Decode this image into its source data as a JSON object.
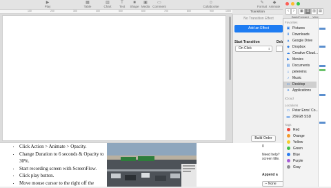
{
  "toolbar": {
    "items": [
      {
        "label": "Play",
        "icon": "play-icon"
      },
      {
        "label": "Table",
        "icon": "table-icon"
      },
      {
        "label": "Chart",
        "icon": "chart-icon"
      },
      {
        "label": "Text",
        "icon": "text-icon"
      },
      {
        "label": "Shape",
        "icon": "shape-icon"
      },
      {
        "label": "Media",
        "icon": "media-icon"
      },
      {
        "label": "Comment",
        "icon": "comment-icon"
      },
      {
        "label": "Collaborate",
        "icon": "collaborate-icon"
      },
      {
        "label": "Format",
        "icon": "format-icon"
      },
      {
        "label": "Animate",
        "icon": "animate-icon"
      }
    ]
  },
  "ruler": {
    "marks": [
      "100",
      "200",
      "300",
      "400",
      "500",
      "600",
      "700",
      "800",
      "900",
      "1000"
    ]
  },
  "inspector": {
    "tab_label": "Transition",
    "no_transition": "No Transition Effect",
    "add_effect": "Add an Effect",
    "start_label": "Start Transition",
    "delay_label": "Delay",
    "start_value": "On Click",
    "build_order": "Build Order"
  },
  "document": {
    "steps": [
      "Click Action > Animate > Opacity.",
      "Change Duration to 6 seconds & Opacity to 30%.",
      "Start recording screen with ScreenFlow.",
      "Click play button.",
      "Move mouse cursor to the right off the"
    ],
    "right_lines": [
      "0",
      "Need help?",
      "screen title.",
      "Append a"
    ],
    "none_option": "-- None"
  },
  "finder": {
    "back_forward": "Back/Forward",
    "view": "View",
    "favorites_header": "Favorites",
    "favorites": [
      {
        "label": "Pictures",
        "icon": "pictures-icon"
      },
      {
        "label": "Downloads",
        "icon": "downloads-icon"
      },
      {
        "label": "Google Drive",
        "icon": "google-drive-icon"
      },
      {
        "label": "Dropbox",
        "icon": "dropbox-icon"
      },
      {
        "label": "Creative Cloud...",
        "icon": "creative-cloud-icon"
      },
      {
        "label": "Movies",
        "icon": "movies-icon"
      },
      {
        "label": "Documents",
        "icon": "documents-icon"
      },
      {
        "label": "petereins",
        "icon": "home-icon"
      },
      {
        "label": "Music",
        "icon": "music-icon"
      },
      {
        "label": "Desktop",
        "icon": "desktop-icon"
      },
      {
        "label": "Applications",
        "icon": "applications-icon"
      }
    ],
    "selected_favorite": "Desktop",
    "icloud_header": "iCloud",
    "locations_header": "Locations",
    "locations": [
      {
        "label": "Peter Enns' Co...",
        "icon": "computer-icon"
      },
      {
        "label": "256GB SSD",
        "icon": "disk-icon"
      }
    ],
    "tags_header": "Tags",
    "tags": [
      {
        "label": "Red",
        "color": "#f0453a"
      },
      {
        "label": "Orange",
        "color": "#f39a2b"
      },
      {
        "label": "Yellow",
        "color": "#f5cc2d"
      },
      {
        "label": "Green",
        "color": "#3fbf4a"
      },
      {
        "label": "Blue",
        "color": "#2b7cf0"
      },
      {
        "label": "Purple",
        "color": "#a65bd6"
      },
      {
        "label": "Gray",
        "color": "#8e8e93"
      }
    ]
  },
  "colors": {
    "accent": "#1e7cf2",
    "traffic_close": "#fc5f57",
    "traffic_min": "#fdbc2e",
    "traffic_max": "#33c748"
  }
}
